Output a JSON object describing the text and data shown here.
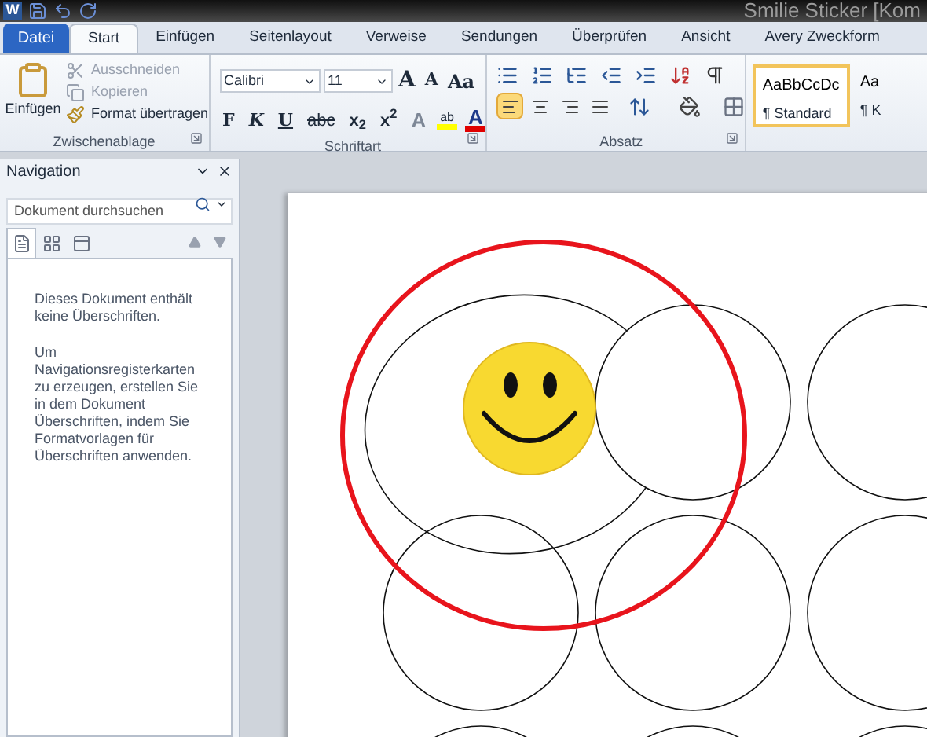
{
  "window": {
    "app_logo": "W",
    "title": "Smilie Sticker [Kom"
  },
  "tabs": [
    {
      "label": "Datei",
      "kind": "file",
      "selected": false
    },
    {
      "label": "Start",
      "kind": "tab",
      "selected": true
    },
    {
      "label": "Einfügen",
      "kind": "tab",
      "selected": false
    },
    {
      "label": "Seitenlayout",
      "kind": "tab",
      "selected": false
    },
    {
      "label": "Verweise",
      "kind": "tab",
      "selected": false
    },
    {
      "label": "Sendungen",
      "kind": "tab",
      "selected": false
    },
    {
      "label": "Überprüfen",
      "kind": "tab",
      "selected": false
    },
    {
      "label": "Ansicht",
      "kind": "tab",
      "selected": false
    },
    {
      "label": "Avery Zweckform",
      "kind": "tab",
      "selected": false
    }
  ],
  "clipboard": {
    "title": "Zwischenablage",
    "paste": "Einfügen",
    "actions": [
      {
        "label": "Ausschneiden",
        "kind": "cut",
        "disabled": true
      },
      {
        "label": "Kopieren",
        "kind": "copy",
        "disabled": true
      },
      {
        "label": "Format übertragen",
        "kind": "brush",
        "disabled": false
      }
    ]
  },
  "font": {
    "title": "Schriftart",
    "family": "Calibri",
    "size": "11",
    "size_buttons": [
      {
        "label": "A",
        "kind": "grow"
      },
      {
        "label": "A",
        "kind": "shrink"
      },
      {
        "label": "Aa",
        "kind": "case"
      }
    ],
    "format_buttons": [
      {
        "label": "F",
        "kind": "bold"
      },
      {
        "label": "K",
        "kind": "italic"
      },
      {
        "label": "U",
        "kind": "underline"
      },
      {
        "label": "abc",
        "kind": "strike"
      },
      {
        "label": "x$_{2}$",
        "kind": "sub"
      },
      {
        "label": "x$^{2}$",
        "kind": "sup"
      }
    ],
    "color_buttons": [
      {
        "label": "A",
        "kind": "effects"
      },
      {
        "label": "ab",
        "kind": "highlight"
      },
      {
        "label": "A",
        "kind": "color"
      }
    ]
  },
  "paragraph": {
    "title": "Absatz",
    "alignments": [
      {
        "kind": "left",
        "selected": true
      },
      {
        "kind": "center",
        "selected": false
      },
      {
        "kind": "right",
        "selected": false
      },
      {
        "kind": "justify",
        "selected": false
      }
    ]
  },
  "styles": [
    {
      "preview": "AaBbCcDc",
      "name": "¶ Standard",
      "selected": true
    },
    {
      "preview": "Aa",
      "name": "¶ K",
      "selected": false
    }
  ],
  "navigation": {
    "title": "Navigation",
    "search_placeholder": "Dokument durchsuchen",
    "views": [
      {
        "kind": "headings",
        "selected": true
      },
      {
        "kind": "pages",
        "selected": false
      },
      {
        "kind": "results",
        "selected": false
      }
    ],
    "message": [
      "Dieses Dokument enthält keine Überschriften.",
      "Um Navigationsregisterkarten zu erzeugen, erstellen Sie in dem Dokument Überschriften, indem Sie Formatvorlagen für Überschriften anwenden."
    ]
  }
}
